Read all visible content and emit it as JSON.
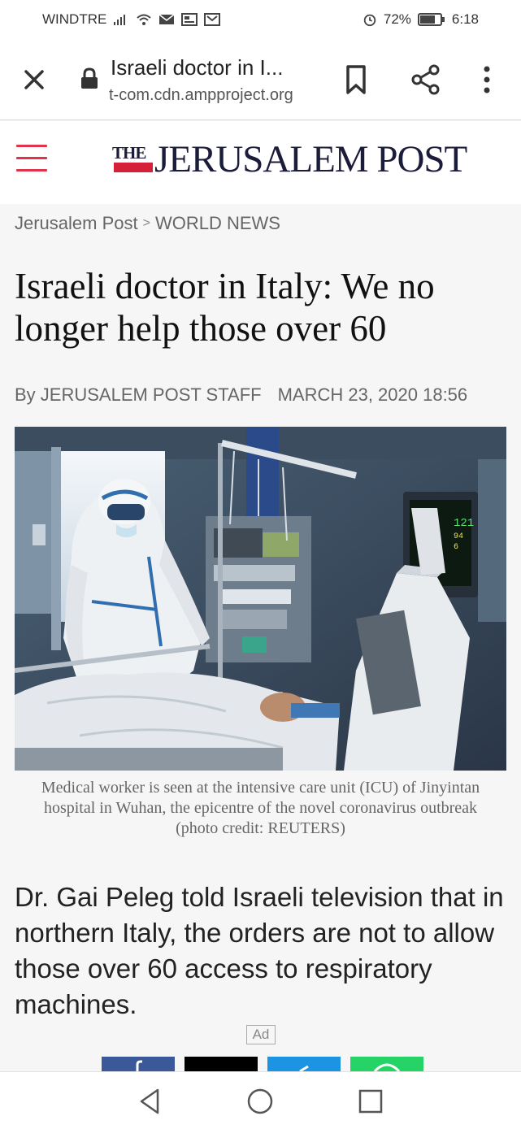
{
  "status_bar": {
    "carrier": "WINDTRE",
    "battery": "72%",
    "time": "6:18"
  },
  "browser": {
    "page_title": "Israeli doctor in I...",
    "url_host": "t-com.cdn.ampproject.org",
    "icons": [
      "close-icon",
      "lock-icon",
      "bookmark-icon",
      "share-icon",
      "more-vert-icon"
    ]
  },
  "site": {
    "logo_the": "THE",
    "logo_main": "JERUSALEM POST",
    "brand_color": "#d5203a",
    "menu_color": "#e0344c"
  },
  "breadcrumb": {
    "home": "Jerusalem Post",
    "separator": ">",
    "section": "WORLD NEWS"
  },
  "article": {
    "headline": "Israeli doctor in Italy: We no longer help those over 60",
    "author": "By JERUSALEM POST STAFF",
    "date": "MARCH 23, 2020 18:56",
    "monitor_readout": [
      "121",
      "94",
      "6"
    ],
    "caption": "Medical worker is seen at the intensive care unit (ICU) of Jinyintan hospital in Wuhan, the epicentre of the novel coronavirus outbreak",
    "photo_credit": "(photo credit: REUTERS)",
    "lead": "Dr. Gai Peleg told Israeli television that in northern Italy, the orders are not to allow those over 60 access to respiratory machines.",
    "ad_label": "Ad"
  },
  "share_buttons": [
    {
      "name": "facebook",
      "color": "#3b5998"
    },
    {
      "name": "twitter-x",
      "color": "#000000"
    },
    {
      "name": "telegram",
      "color": "#1c93e3"
    },
    {
      "name": "whatsapp",
      "color": "#25d366"
    }
  ],
  "nav": [
    "back-icon",
    "home-icon",
    "recents-icon"
  ]
}
